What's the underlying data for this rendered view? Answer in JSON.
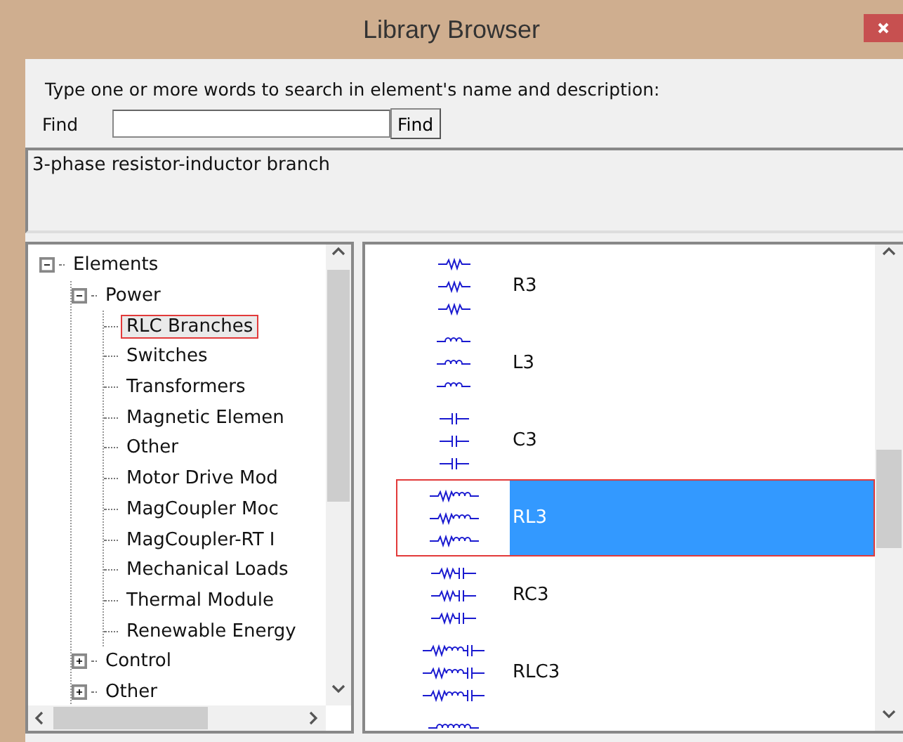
{
  "window": {
    "title": "Library Browser"
  },
  "search": {
    "instructions": "Type one or more words to search in element's name and  description:",
    "label": "Find",
    "button": "Find"
  },
  "description": "3-phase resistor-inductor branch",
  "tree": [
    {
      "label": "Elements",
      "expanded": true,
      "selected": false,
      "children": [
        {
          "label": "Power",
          "expanded": true,
          "selected": false,
          "children": [
            {
              "label": "RLC Branches",
              "selected": true
            },
            {
              "label": "Switches",
              "selected": false
            },
            {
              "label": "Transformers",
              "selected": false
            },
            {
              "label": "Magnetic Elemen",
              "selected": false
            },
            {
              "label": "Other",
              "selected": false
            },
            {
              "label": "Motor Drive Mod",
              "selected": false
            },
            {
              "label": "MagCoupler Moc",
              "selected": false
            },
            {
              "label": "MagCoupler-RT I",
              "selected": false
            },
            {
              "label": "Mechanical Loads",
              "selected": false
            },
            {
              "label": "Thermal Module",
              "selected": false
            },
            {
              "label": "Renewable Energy",
              "selected": false
            }
          ]
        },
        {
          "label": "Control",
          "expanded": false,
          "selected": false
        },
        {
          "label": "Other",
          "expanded": false,
          "selected": false
        }
      ]
    }
  ],
  "elements": [
    {
      "kind": "resistor",
      "name": "R3",
      "selected": false
    },
    {
      "kind": "inductor",
      "name": "L3",
      "selected": false
    },
    {
      "kind": "capacitor",
      "name": "C3",
      "selected": false
    },
    {
      "kind": "rl",
      "name": "RL3",
      "selected": true
    },
    {
      "kind": "rc",
      "name": "RC3",
      "selected": false
    },
    {
      "kind": "rlc",
      "name": "RLC3",
      "selected": false
    },
    {
      "kind": "coupled"
    }
  ]
}
